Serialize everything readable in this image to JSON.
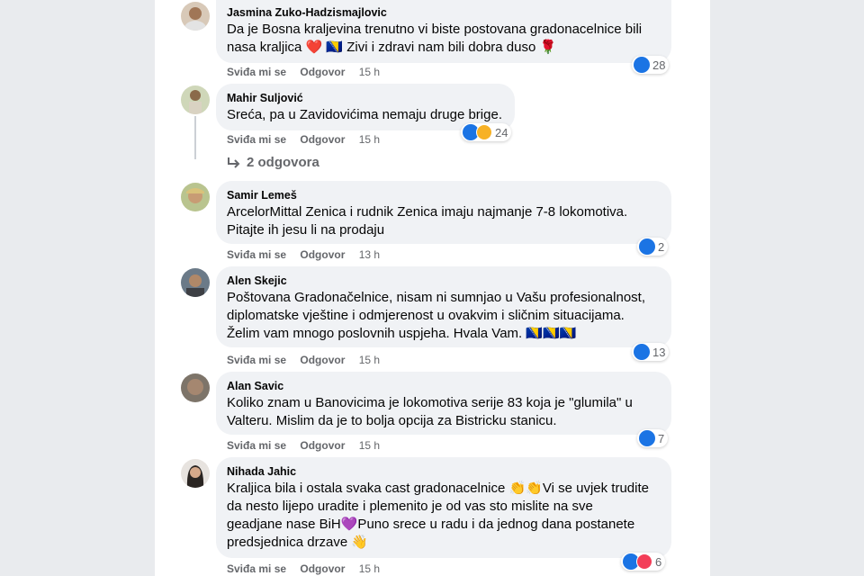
{
  "comments": [
    {
      "author": "Jasmina Zuko-Hadzismajlovic",
      "text_lines": [
        "Da je Bosna kraljevina trenutno vi biste postovana gradonacelnice bili",
        "nasa kraljica ❤️ 🇧🇦 Zivi i zdravi nam bili dobra duso 🌹"
      ],
      "like": "Sviđa mi se",
      "reply": "Odgovor",
      "time": "15 h",
      "reaction_count": "28",
      "reactions": [
        "like"
      ]
    },
    {
      "author": "Mahir Suljović",
      "text_lines": [
        "Sreća, pa u Zavidovićima nemaju druge brige."
      ],
      "like": "Sviđa mi se",
      "reply": "Odgovor",
      "time": "15 h",
      "reaction_count": "24",
      "reactions": [
        "like",
        "haha"
      ],
      "replies_label": "2 odgovora"
    },
    {
      "author": "Samir Lemeš",
      "text_lines": [
        "ArcelorMittal Zenica i rudnik Zenica imaju najmanje 7-8 lokomotiva.",
        "Pitajte ih jesu li na prodaju"
      ],
      "like": "Sviđa mi se",
      "reply": "Odgovor",
      "time": "13 h",
      "reaction_count": "2",
      "reactions": [
        "like"
      ]
    },
    {
      "author": "Alen Skejic",
      "text_lines": [
        "Poštovana Gradonačelnice, nisam ni sumnjao u Vašu profesionalnost,",
        "diplomatske vještine i odmjerenost u ovakvim i sličnim situacijama.",
        "Želim vam mnogo poslovnih uspjeha. Hvala Vam. 🇧🇦🇧🇦🇧🇦"
      ],
      "like": "Sviđa mi se",
      "reply": "Odgovor",
      "time": "15 h",
      "reaction_count": "13",
      "reactions": [
        "like"
      ]
    },
    {
      "author": "Alan Savic",
      "text_lines": [
        "Koliko znam u Banovicima je lokomotiva serije 83 koja je \"glumila\" u",
        "Valteru. Mislim da je to bolja opcija za Bistricku stanicu."
      ],
      "like": "Sviđa mi se",
      "reply": "Odgovor",
      "time": "15 h",
      "reaction_count": "7",
      "reactions": [
        "like"
      ]
    },
    {
      "author": "Nihada Jahic",
      "text_lines": [
        "Kraljica bila i ostala svaka cast gradonacelnice 👏👏Vi se uvjek trudite",
        "da nesto lijepo uradite i plemenito je od vas sto mislite na sve",
        "geadjane nase BiH💜Puno srece u radu i da jednog dana postanete",
        "predsjednica drzave 👋"
      ],
      "like": "Sviđa mi se",
      "reply": "Odgovor",
      "time": "15 h",
      "reaction_count": "6",
      "reactions": [
        "like",
        "love"
      ]
    }
  ],
  "colors": {
    "like": "#1b74e4",
    "haha": "#f7b125",
    "love": "#f33e58",
    "bubble": "#f0f2f5",
    "meta": "#65676b"
  },
  "icons": {
    "reply_arrow": "return-arrow-icon"
  }
}
